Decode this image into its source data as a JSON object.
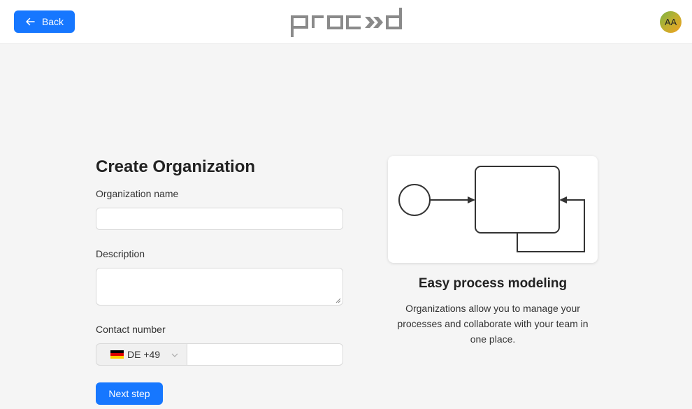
{
  "header": {
    "back_label": "Back",
    "logo_text": "PROCEED",
    "avatar_initials": "AA"
  },
  "form": {
    "title": "Create Organization",
    "name_label": "Organization name",
    "name_value": "",
    "description_label": "Description",
    "description_value": "",
    "contact_label": "Contact number",
    "country_code": "DE +49",
    "phone_value": "",
    "next_label": "Next step"
  },
  "feature": {
    "title": "Easy process modeling",
    "description": "Organizations allow you to manage your processes and collaborate with your team in one place."
  },
  "colors": {
    "primary": "#1677ff",
    "logo": "#8a8a8a"
  }
}
